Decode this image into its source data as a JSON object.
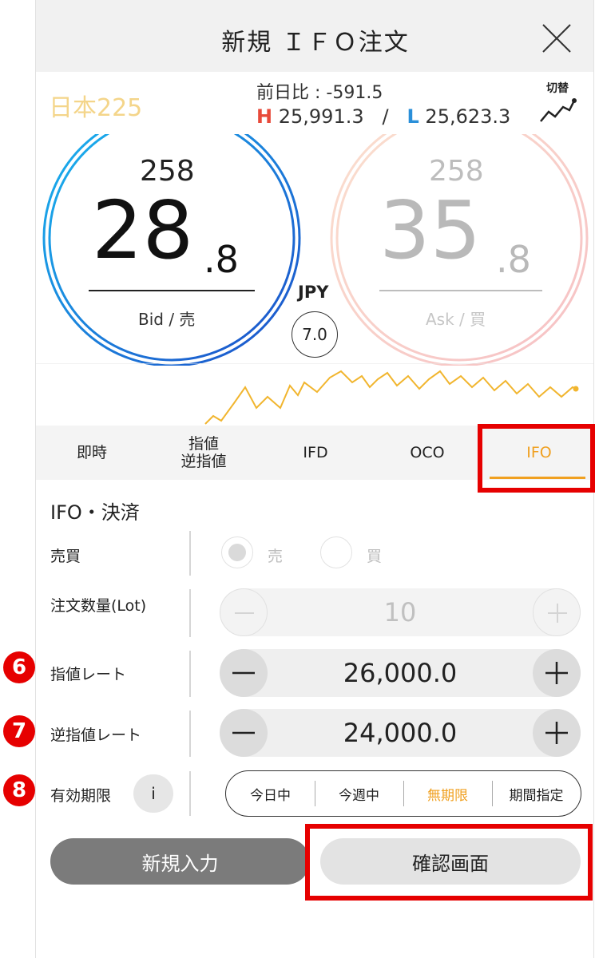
{
  "header": {
    "title": "新規 ＩＦＯ注文"
  },
  "instrument": {
    "symbol": "日本225",
    "prev_change": "前日比 : -591.5",
    "high_label": "H",
    "high_value": "25,991.3",
    "separator": "/",
    "low_label": "L",
    "low_value": "25,623.3",
    "switch_label": "切替"
  },
  "bid": {
    "big_prefix": "258",
    "main": "28",
    "decimal": ".8",
    "label": "Bid / 売"
  },
  "ask": {
    "big_prefix": "258",
    "main": "35",
    "decimal": ".8",
    "label": "Ask / 買"
  },
  "spread": {
    "currency": "JPY",
    "value": "7.0"
  },
  "order_tabs": [
    {
      "label": "即時"
    },
    {
      "label": "指値\n逆指値"
    },
    {
      "label": "IFD"
    },
    {
      "label": "OCO"
    },
    {
      "label": "IFO",
      "active": true
    }
  ],
  "form": {
    "section_title": "IFO・決済",
    "side": {
      "label": "売買",
      "sell": "売",
      "buy": "買",
      "selected": "sell"
    },
    "quantity": {
      "label": "注文数量(Lot)",
      "value": "10"
    },
    "limit_rate": {
      "label": "指値レート",
      "value": "26,000.0"
    },
    "stop_rate": {
      "label": "逆指値レート",
      "value": "24,000.0"
    },
    "expiry": {
      "label": "有効期限",
      "info": "i",
      "options": [
        "今日中",
        "今週中",
        "無期限",
        "期間指定"
      ],
      "selected": "無期限"
    }
  },
  "buttons": {
    "new_input": "新規入力",
    "confirm": "確認画面"
  },
  "annotations": {
    "badge6": "6",
    "badge7": "7",
    "badge8": "8"
  },
  "colors": {
    "accent": "#f0a020",
    "highlight": "#e60000",
    "bid_ring": "#1f6fd6",
    "ask_ring": "#f6c9c2"
  }
}
